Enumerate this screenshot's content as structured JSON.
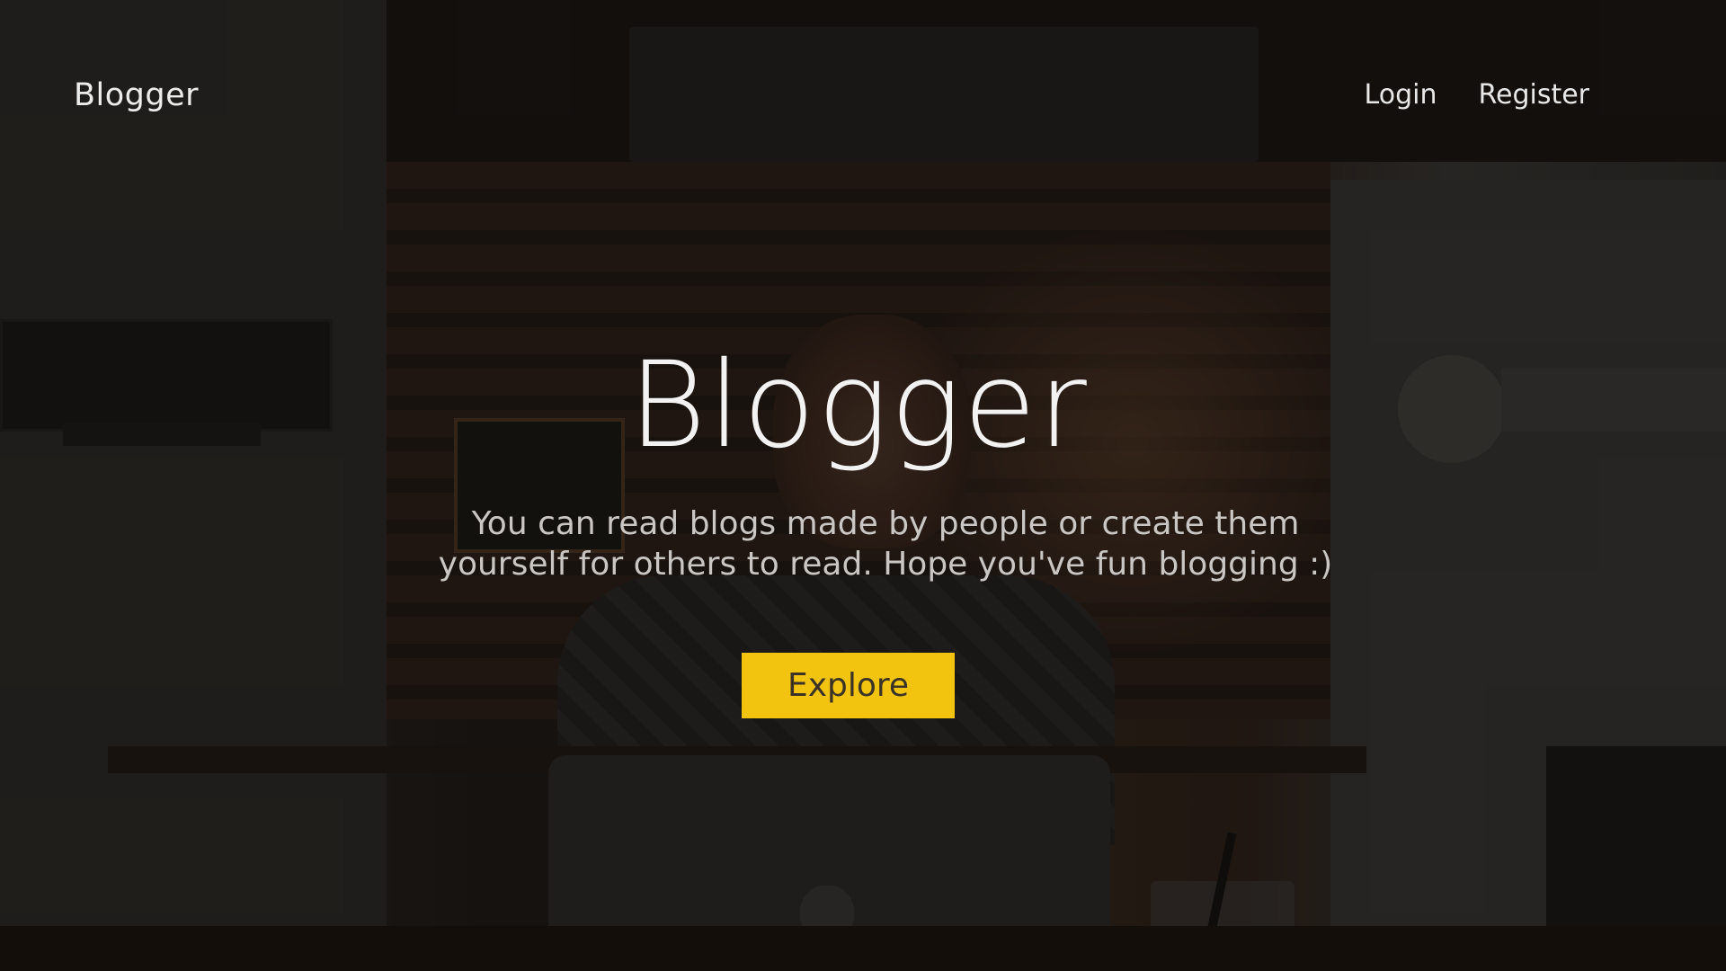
{
  "navbar": {
    "brand": "Blogger",
    "links": [
      {
        "label": "Login"
      },
      {
        "label": "Register"
      }
    ]
  },
  "hero": {
    "title": "Blogger",
    "subtitle": "You can read blogs made by people or create them yourself for others to read. Hope you've fun blogging :)",
    "cta_label": "Explore"
  },
  "colors": {
    "accent": "#f2c40f",
    "overlay": "#0a0806"
  }
}
